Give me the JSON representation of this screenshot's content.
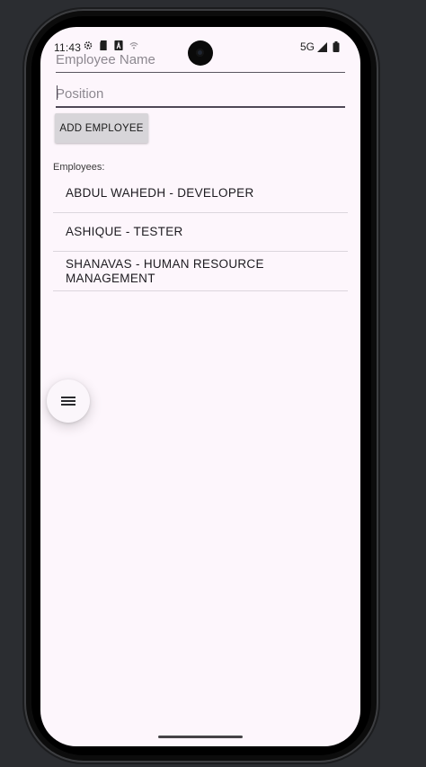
{
  "status_bar": {
    "time": "11:43",
    "network": "5G"
  },
  "form": {
    "name_placeholder": "Employee Name",
    "position_placeholder": "Position",
    "add_button_label": "ADD EMPLOYEE"
  },
  "employees": {
    "heading": "Employees:",
    "items": [
      {
        "label": "ABDUL WAHEDH - DEVELOPER"
      },
      {
        "label": "ASHIQUE - TESTER"
      },
      {
        "label": "SHANAVAS - HUMAN RESOURCE MANAGEMENT"
      }
    ]
  },
  "fab": {
    "icon": "menu-icon"
  },
  "colors": {
    "screen_bg": "#fdf6fc",
    "frame": "#0c0c0c",
    "button_bg": "#d7d5d9",
    "divider": "#dcd6dd"
  }
}
